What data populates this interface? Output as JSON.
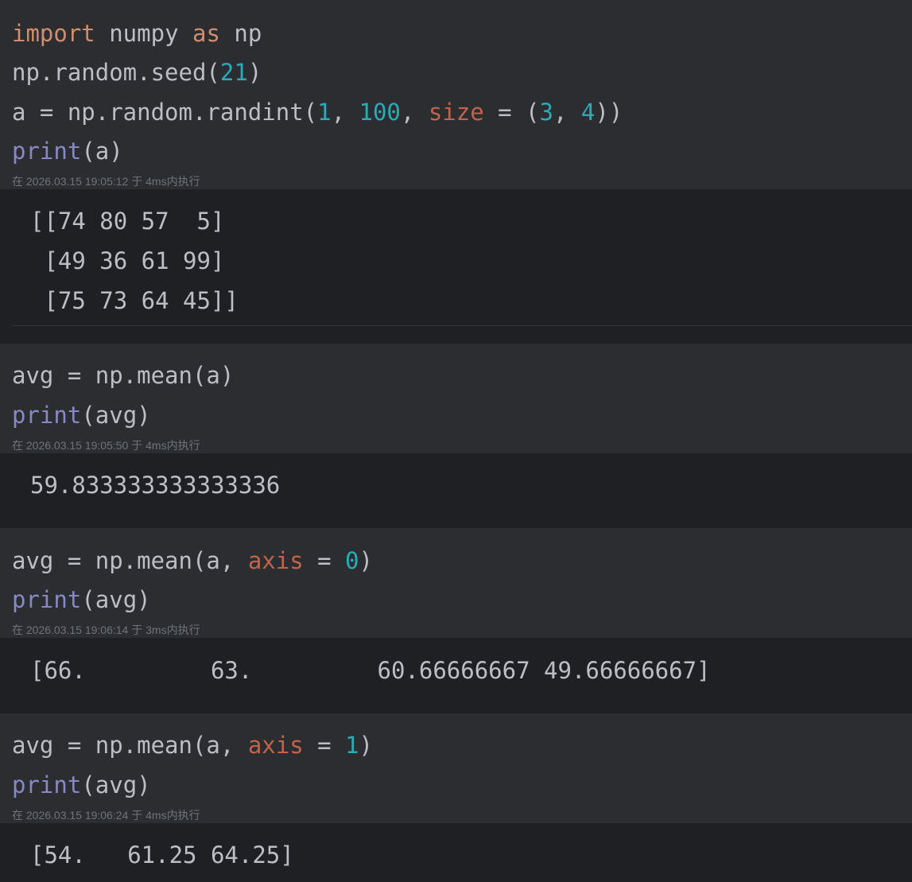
{
  "cells": [
    {
      "code": {
        "l1": {
          "t1": "import",
          "t2": " numpy ",
          "t3": "as",
          "t4": " np"
        },
        "l2": {
          "t1": "np.random.seed(",
          "t2": "21",
          "t3": ")"
        },
        "l3": {
          "t1": "a = np.random.randint(",
          "t2": "1",
          "t3": ", ",
          "t4": "100",
          "t5": ", ",
          "t6": "size",
          "t7": " = (",
          "t8": "3",
          "t9": ", ",
          "t10": "4",
          "t11": "))"
        },
        "l4": {
          "t1": "print",
          "t2": "(a)"
        }
      },
      "meta": "在 2026.03.15 19:05:12 于 4ms内执行",
      "output": [
        "[[74 80 57  5]",
        " [49 36 61 99]",
        " [75 73 64 45]]"
      ]
    },
    {
      "code": {
        "l1": {
          "t1": "avg = np.mean(a)"
        },
        "l2": {
          "t1": "print",
          "t2": "(avg)"
        }
      },
      "meta": "在 2026.03.15 19:05:50 于 4ms内执行",
      "output": [
        "59.833333333333336"
      ]
    },
    {
      "code": {
        "l1": {
          "t1": "avg = np.mean(a, ",
          "t2": "axis",
          "t3": " = ",
          "t4": "0",
          "t5": ")"
        },
        "l2": {
          "t1": "print",
          "t2": "(avg)"
        }
      },
      "meta": "在 2026.03.15 19:06:14 于 3ms内执行",
      "output": [
        "[66.         63.         60.66666667 49.66666667]"
      ]
    },
    {
      "code": {
        "l1": {
          "t1": "avg = np.mean(a, ",
          "t2": "axis",
          "t3": " = ",
          "t4": "1",
          "t5": ")"
        },
        "l2": {
          "t1": "print",
          "t2": "(avg)"
        }
      },
      "meta": "在 2026.03.15 19:06:24 于 4ms内执行",
      "output": [
        "[54.   61.25 64.25]"
      ]
    }
  ],
  "colors": {
    "background": "#1f2023",
    "cell_input_bg": "#2b2d30",
    "text": "#bcbec4",
    "keyword": "#cf8e6d",
    "number": "#2aacb8",
    "named_param": "#c0644b",
    "builtin": "#8888c6",
    "meta": "#6f737a"
  }
}
